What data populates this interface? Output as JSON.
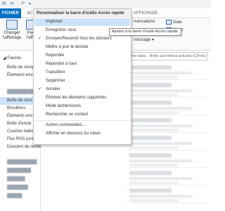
{
  "qat": {
    "icons": [
      "outlook-icon",
      "send-receive-icon",
      "undo-icon",
      "customize-arrow-icon"
    ]
  },
  "tabs": {
    "file": "FICHIER",
    "home_partial": "AC",
    "view": "AFFICHAGE"
  },
  "ribbon": {
    "change_view_line1": "Changer",
    "change_view_line2": "l'affichage",
    "partial_button": "Par",
    "partial_button2": "l'affi",
    "conversations_partial": "nversations",
    "date_label": "Date",
    "subject_partial": "Objet",
    "message_partial": "message"
  },
  "nav": {
    "favorites": "Favoris",
    "favorites_inbox": "Boîte de récep",
    "favorites_sent": "Éléments envoy",
    "account_inbox": "Boîte de réce",
    "drafts": "Brouillons",
    "sent": "Éléments env",
    "outbox": "Boîte d'envoi",
    "junk": "Courrier indés",
    "rss": "Flux RSS (uniquement cet ordina...",
    "search_folders": "Dossiers de recherche"
  },
  "search": {
    "placeholder": "rcher dans : Boîte aux lettres actuelle (Ctrl+E)"
  },
  "menu": {
    "title": "Personnaliser la barre d'outils Accès rapide",
    "items": [
      {
        "label": "Imprimer",
        "checked": false
      },
      {
        "label": "Enregistrer sous",
        "checked": false
      },
      {
        "label": "Envoyer/Recevoir tous les dossiers",
        "checked": true
      },
      {
        "label": "Mettre à jour le dossier",
        "checked": false
      },
      {
        "label": "Répondre",
        "checked": false
      },
      {
        "label": "Répondre à tous",
        "checked": false
      },
      {
        "label": "Transférer",
        "checked": false
      },
      {
        "label": "Supprimer",
        "checked": false
      },
      {
        "label": "Annuler",
        "checked": true
      },
      {
        "label": "Éliminer les éléments supprimés",
        "checked": false
      },
      {
        "label": "Mode tactile/souris",
        "checked": false
      },
      {
        "label": "Rechercher un contact",
        "checked": false
      },
      {
        "label": "Autres commandes...",
        "checked": false
      },
      {
        "label": "Afficher en dessous du ruban",
        "checked": false
      }
    ],
    "checkmark": "✓"
  },
  "tooltip": {
    "text": "Ajouter à la barre d'outils Accès rapide"
  }
}
